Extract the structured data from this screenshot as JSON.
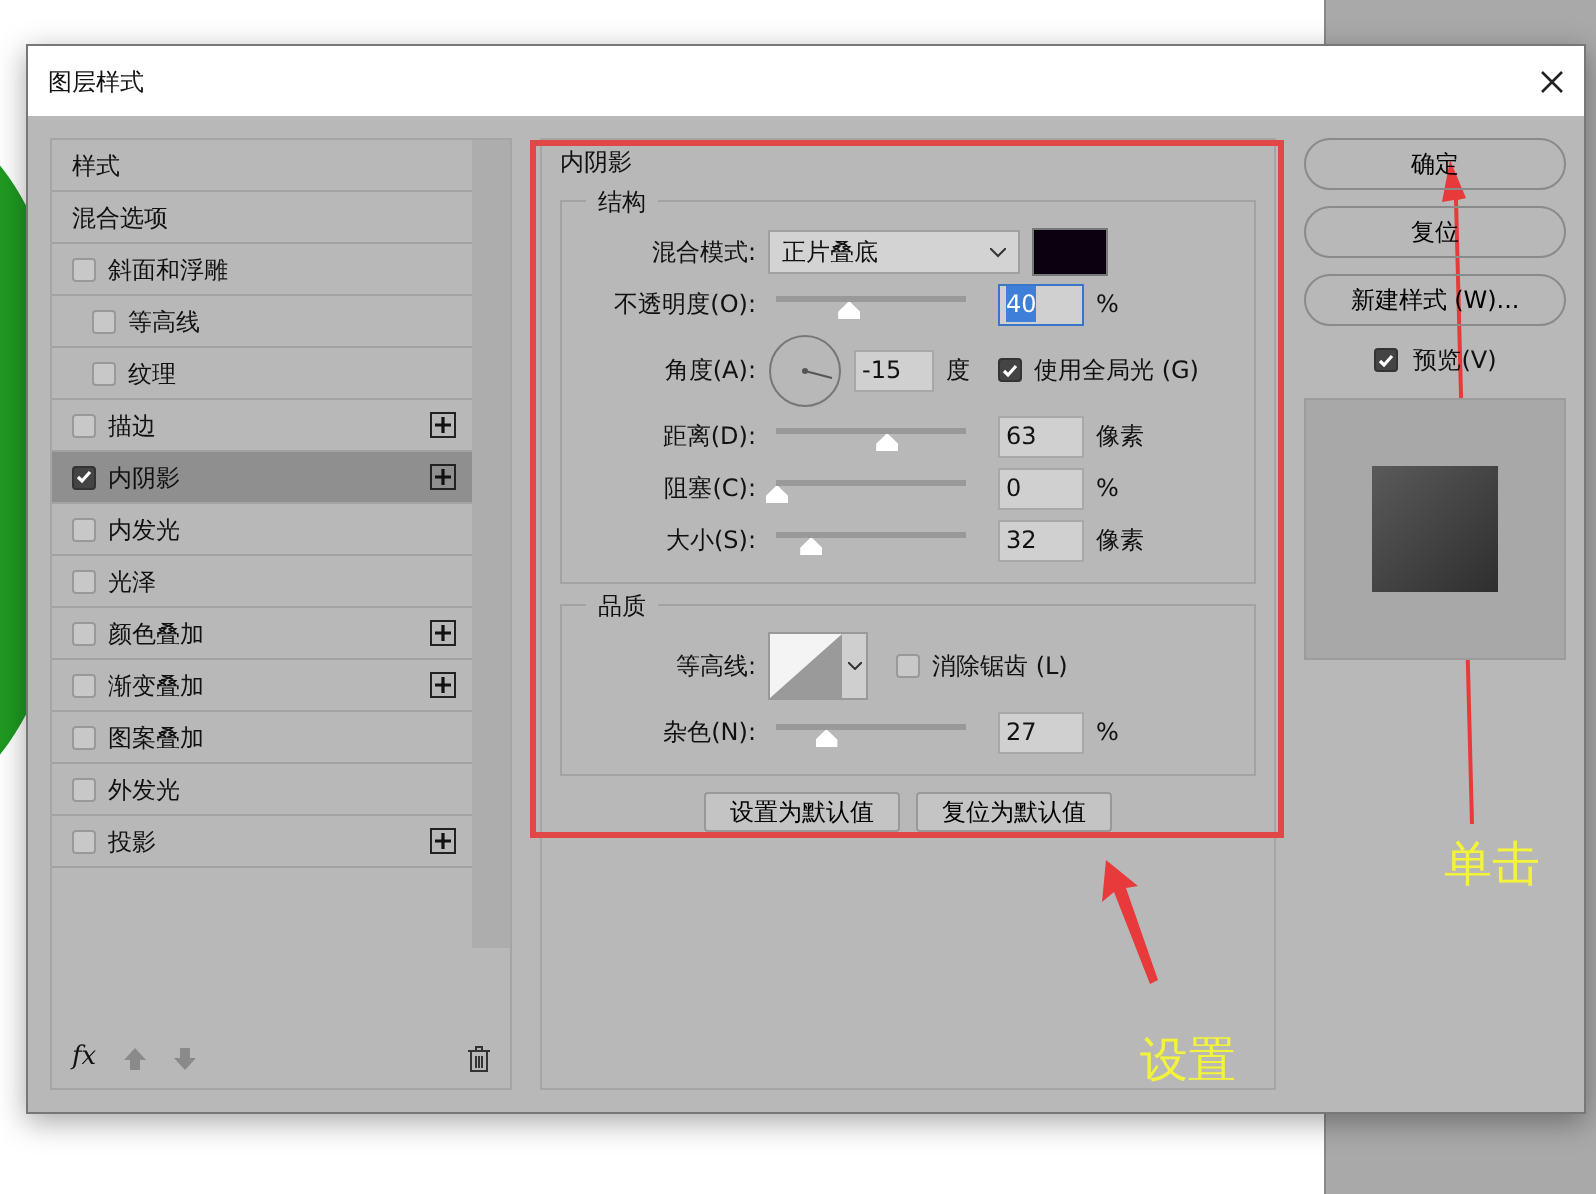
{
  "window": {
    "title": "图层样式"
  },
  "styles_list": {
    "items": [
      {
        "kind": "heading",
        "label": "样式",
        "selected": false
      },
      {
        "kind": "heading",
        "label": "混合选项",
        "selected": false
      },
      {
        "kind": "effect",
        "label": "斜面和浮雕",
        "checked": false,
        "selected": false,
        "addable": false,
        "children": [
          {
            "kind": "effect",
            "label": "等高线",
            "checked": false,
            "selected": false,
            "addable": false
          },
          {
            "kind": "effect",
            "label": "纹理",
            "checked": false,
            "selected": false,
            "addable": false
          }
        ]
      },
      {
        "kind": "effect",
        "label": "描边",
        "checked": false,
        "selected": false,
        "addable": true
      },
      {
        "kind": "effect",
        "label": "内阴影",
        "checked": true,
        "selected": true,
        "addable": true
      },
      {
        "kind": "effect",
        "label": "内发光",
        "checked": false,
        "selected": false,
        "addable": false
      },
      {
        "kind": "effect",
        "label": "光泽",
        "checked": false,
        "selected": false,
        "addable": false
      },
      {
        "kind": "effect",
        "label": "颜色叠加",
        "checked": false,
        "selected": false,
        "addable": true
      },
      {
        "kind": "effect",
        "label": "渐变叠加",
        "checked": false,
        "selected": false,
        "addable": true
      },
      {
        "kind": "effect",
        "label": "图案叠加",
        "checked": false,
        "selected": false,
        "addable": false
      },
      {
        "kind": "effect",
        "label": "外发光",
        "checked": false,
        "selected": false,
        "addable": false
      },
      {
        "kind": "effect",
        "label": "投影",
        "checked": false,
        "selected": false,
        "addable": true
      }
    ],
    "toolbar": {
      "fx": "fx"
    }
  },
  "panel": {
    "title": "内阴影",
    "structure": {
      "title": "结构",
      "blend_mode": {
        "label": "混合模式:",
        "value": "正片叠底"
      },
      "opacity": {
        "label": "不透明度(O):",
        "level": 0.38,
        "value": "40",
        "unit": "%",
        "selected": true
      },
      "angle": {
        "label": "角度(A):",
        "value": "-15",
        "unit": "度",
        "global_light": {
          "label": "使用全局光 (G)",
          "checked": true
        }
      },
      "sliders": [
        {
          "label": "距离(D):",
          "level": 0.58,
          "value": "63",
          "unit": "像素",
          "selected": false
        },
        {
          "label": "阻塞(C):",
          "level": 0,
          "value": "0",
          "unit": "%",
          "selected": false
        },
        {
          "label": "大小(S):",
          "level": 0.18,
          "value": "32",
          "unit": "像素",
          "selected": false
        }
      ]
    },
    "quality": {
      "title": "品质",
      "contour": {
        "label": "等高线:"
      },
      "anti_alias": {
        "label": "消除锯齿 (L)",
        "checked": false
      },
      "noise": {
        "label": "杂色(N):",
        "level": 0.26,
        "value": "27",
        "unit": "%",
        "selected": false
      }
    },
    "buttons": [
      "设置为默认值",
      "复位为默认值"
    ]
  },
  "right": {
    "buttons": [
      "确定",
      "复位",
      "新建样式 (W)..."
    ],
    "preview": {
      "label": "预览(V)",
      "checked": true
    }
  },
  "annotations": [
    {
      "text": "设置"
    },
    {
      "text": "单击"
    }
  ]
}
